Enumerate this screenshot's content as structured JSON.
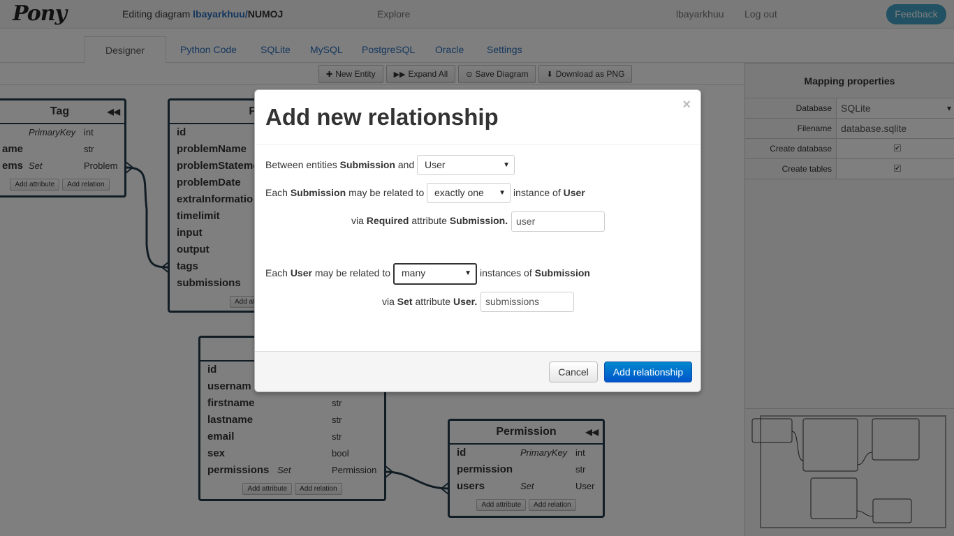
{
  "header": {
    "logo": "Pony",
    "editing_label": "Editing diagram",
    "user": "lbayarkhuu",
    "separator": "/",
    "project": "NUMOJ",
    "explore": "Explore",
    "username_link": "lbayarkhuu",
    "logout": "Log out",
    "feedback": "Feedback"
  },
  "tabs": [
    "Designer",
    "Python Code",
    "SQLite",
    "MySQL",
    "PostgreSQL",
    "Oracle",
    "Settings"
  ],
  "toolbar": {
    "new_entity": "New Entity",
    "expand_all": "Expand All",
    "save_diagram": "Save Diagram",
    "download_png": "Download as PNG"
  },
  "entities": {
    "tag": {
      "name": "Tag",
      "rows": [
        {
          "name": "",
          "kind": "PrimaryKey",
          "type": "int"
        },
        {
          "name": "ame",
          "kind": "",
          "type": "str"
        },
        {
          "name": "ems",
          "kind": "Set",
          "type": "Problem"
        }
      ]
    },
    "problem": {
      "name": "P",
      "rows": [
        "id",
        "problemName",
        "problemStateme",
        "problemDate",
        "extraInformatio",
        "timelimit",
        "input",
        "output",
        "tags",
        "submissions"
      ]
    },
    "user": {
      "rows": [
        {
          "name": "id",
          "type": ""
        },
        {
          "name": "usernam",
          "type": ""
        },
        {
          "name": "firstname",
          "type": "str"
        },
        {
          "name": "lastname",
          "type": "str"
        },
        {
          "name": "email",
          "type": "str"
        },
        {
          "name": "sex",
          "type": "bool"
        },
        {
          "name": "permissions",
          "kind": "Set",
          "type": "Permission"
        }
      ]
    },
    "permission": {
      "name": "Permission",
      "rows": [
        {
          "name": "id",
          "kind": "PrimaryKey",
          "type": "int"
        },
        {
          "name": "permission",
          "kind": "",
          "type": "str"
        },
        {
          "name": "users",
          "kind": "Set",
          "type": "User"
        }
      ]
    },
    "add_attribute": "Add attribute",
    "add_relation": "Add relation",
    "add_attr_short": "Add att",
    "collapse": "◀◀"
  },
  "mapping": {
    "title": "Mapping properties",
    "database_label": "Database",
    "database_value": "SQLite",
    "filename_label": "Filename",
    "filename_value": "database.sqlite",
    "create_db_label": "Create database",
    "create_tables_label": "Create tables",
    "check": "✔"
  },
  "modal": {
    "title": "Add new relationship",
    "close": "×",
    "between": "Between entities",
    "entity_a": "Submission",
    "and": "and",
    "entity_b_select": "User",
    "each": "Each",
    "may_be_related_to": "may be related to",
    "card_a_select": "exactly one",
    "instance_of": "instance of",
    "via": "via",
    "req_kind": "Required",
    "attribute_word": "attribute",
    "attr_a_prefix": "Submission.",
    "attr_a_value": "user",
    "card_b_select": "many",
    "instances_of": "instances of",
    "set_kind": "Set",
    "attr_b_prefix": "User.",
    "attr_b_value": "submissions",
    "cancel": "Cancel",
    "add": "Add relationship"
  }
}
